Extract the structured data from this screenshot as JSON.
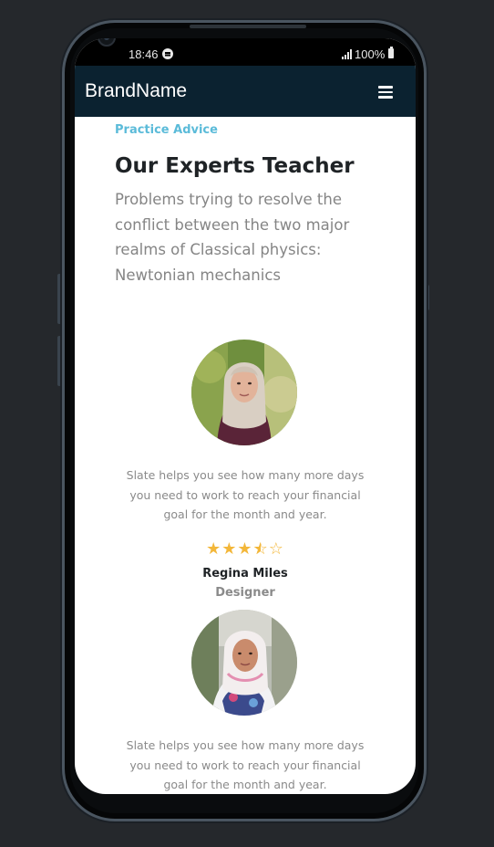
{
  "status_bar": {
    "time": "18:46",
    "battery": "100%",
    "icons": [
      "spotify-icon",
      "signal-icon",
      "battery-icon"
    ]
  },
  "navbar": {
    "brand": "BrandName",
    "menu_icon": "hamburger-icon",
    "background": "#0b2230"
  },
  "hero": {
    "eyebrow": "Practice Advice",
    "title": "Our Experts Teacher",
    "description": "Problems trying to resolve the conflict between the two major realms of Classical physics: Newtonian mechanics"
  },
  "testimonials": [
    {
      "quote": "Slate helps you see how many more days you need to work to reach your financial goal for the month and year.",
      "rating": 3.5,
      "rating_max": 5,
      "name": "Regina Miles",
      "role": "Designer"
    },
    {
      "quote": "Slate helps you see how many more days you need to work to reach your financial goal for the month and year."
    }
  ],
  "colors": {
    "accent": "#5bbbd9",
    "star": "#f3b73a",
    "heading": "#1f2326",
    "muted": "#858585"
  }
}
